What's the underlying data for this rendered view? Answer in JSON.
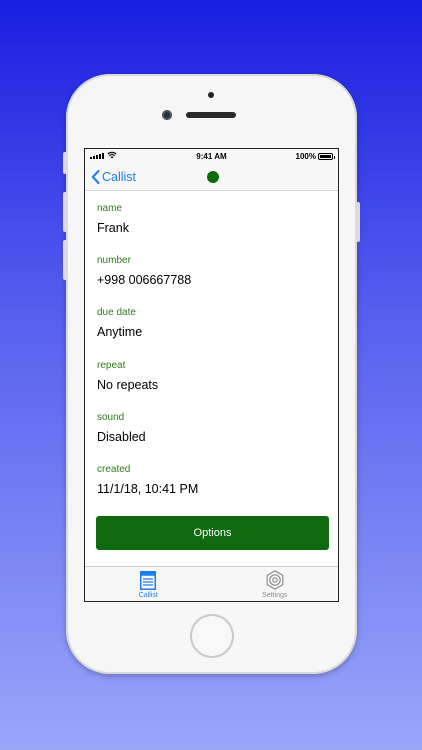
{
  "status_bar": {
    "time": "9:41 AM",
    "battery": "100%",
    "battery_level": 1.0
  },
  "nav": {
    "back_label": "Callist",
    "status_dot_color": "#106b10"
  },
  "fields": [
    {
      "label": "name",
      "value": "Frank"
    },
    {
      "label": "number",
      "value": "+998 006667788"
    },
    {
      "label": "due date",
      "value": "Anytime"
    },
    {
      "label": "repeat",
      "value": "No repeats"
    },
    {
      "label": "sound",
      "value": "Disabled"
    },
    {
      "label": "created",
      "value": "11/1/18, 10:41 PM"
    }
  ],
  "options_button": {
    "label": "Options",
    "color": "#0f6a0f"
  },
  "tabs": [
    {
      "label": "Callist",
      "icon": "list-document-icon",
      "active": true
    },
    {
      "label": "Settings",
      "icon": "gear-icon",
      "active": false
    }
  ],
  "colors": {
    "accent": "#1e7cf6",
    "label_green": "#2d7d1b",
    "background_top": "#1a1ee0",
    "background_bottom": "#9aa6f9"
  }
}
